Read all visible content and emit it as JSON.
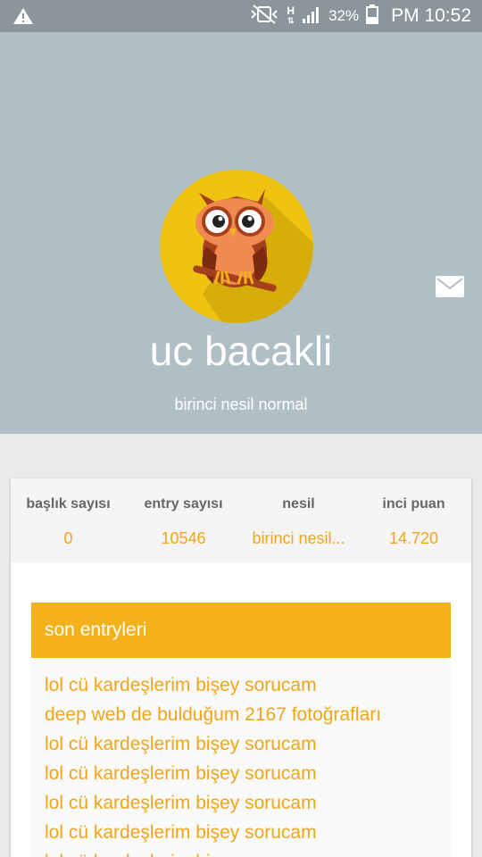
{
  "status_bar": {
    "battery": "32%",
    "time": "PM 10:52",
    "network_type": "H"
  },
  "profile": {
    "username": "uc bacakli",
    "generation": "birinci nesil normal",
    "avatar_icon": "owl-avatar-icon",
    "message_icon": "mail-icon"
  },
  "stats": [
    {
      "label": "başlık sayısı",
      "value": "0"
    },
    {
      "label": "entry sayısı",
      "value": "10546"
    },
    {
      "label": "nesil",
      "value": "birinci nesil..."
    },
    {
      "label": "inci puan",
      "value": "14.720"
    }
  ],
  "recent_entries": {
    "title": "son entryleri",
    "items": [
      "lol cü kardeşlerim bişey sorucam",
      "deep web de bulduğum 2167 fotoğrafları",
      "lol cü kardeşlerim bişey sorucam",
      "lol cü kardeşlerim bişey sorucam",
      "lol cü kardeşlerim bişey sorucam",
      "lol cü kardeşlerim bişey sorucam",
      "lol cü kardeşlerim bişey sorucam"
    ]
  },
  "colors": {
    "header_bg": "#b0bec5",
    "accent": "#f5b11a",
    "link_text": "#f0a519",
    "avatar_bg": "#efc30f"
  }
}
